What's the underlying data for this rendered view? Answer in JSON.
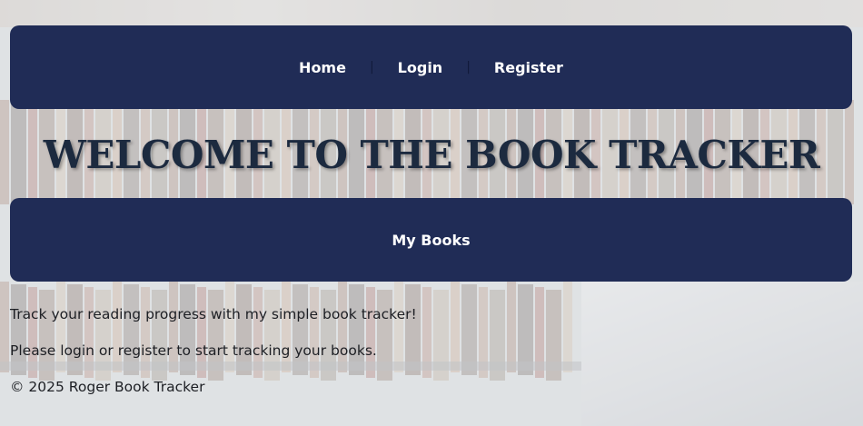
{
  "nav": {
    "items": [
      {
        "label": "Home"
      },
      {
        "label": "Login"
      },
      {
        "label": "Register"
      }
    ],
    "separator": "|"
  },
  "page": {
    "title": "WELCOME TO THE BOOK TRACKER",
    "my_books_label": "My Books",
    "intro": "Track your reading progress with my simple book tracker!",
    "prompt": "Please login or register to start tracking your books."
  },
  "footer": {
    "text": "© 2025 Roger Book Tracker"
  },
  "colors": {
    "nav_bg": "#202c56",
    "title_text": "#1c2a3f"
  }
}
